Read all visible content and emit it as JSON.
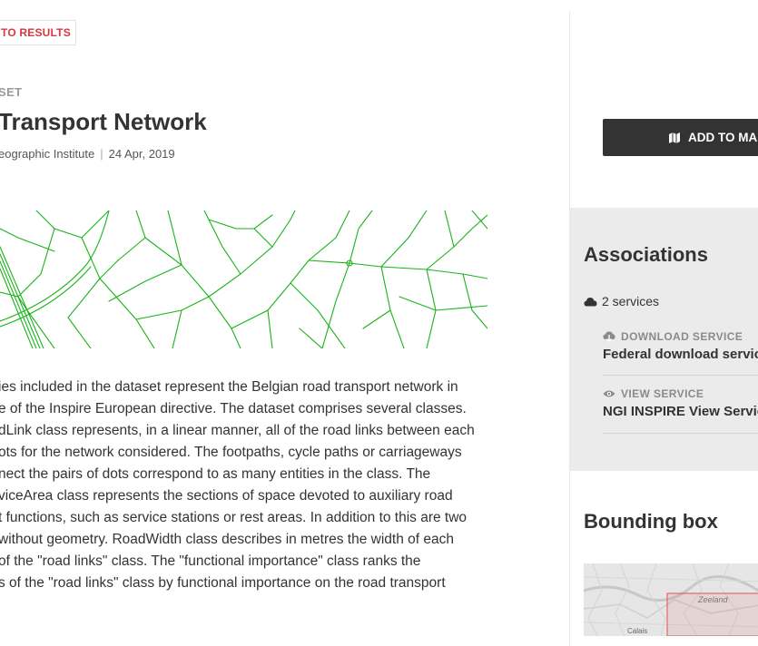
{
  "back": {
    "label": "TO RESULTS"
  },
  "record": {
    "kind": "SET",
    "title": "Transport Network",
    "publisher": "eographic Institute",
    "date": "24 Apr, 2019"
  },
  "description": [
    "ies included in the dataset represent the Belgian road transport network in",
    "e of the Inspire European directive. The dataset comprises several classes.",
    "dLink class represents, in a linear manner, all of the road links between each",
    "ots for the network considered. The footpaths, cycle paths or carriageways",
    "nect the pairs of dots correspond to as many entities in the class. The",
    "viceArea class represents the sections of space devoted to auxiliary road",
    "t functions, such as service stations or rest areas. In addition to this are two",
    "without geometry. RoadWidth class describes in metres the width of each",
    " of the \"road links\" class. The \"functional importance\" class ranks the",
    "s of the \"road links\" class by functional importance on the road transport"
  ],
  "actions": {
    "add_to_map": "ADD TO MAP"
  },
  "associations": {
    "title": "Associations",
    "count_label": "2 services",
    "services": [
      {
        "type": "DOWNLOAD SERVICE",
        "icon": "cloud-download-icon",
        "name": "Federal download service"
      },
      {
        "type": "VIEW SERVICE",
        "icon": "eye-icon",
        "name": "NGI INSPIRE View Service"
      }
    ]
  },
  "bounding_box": {
    "title": "Bounding box",
    "map_labels": [
      "Zeeland",
      "Calais"
    ]
  },
  "colors": {
    "accent_red": "#d9363e",
    "road_green": "#19b319",
    "dark_button": "#333333",
    "panel_gray": "#ebebeb",
    "bbox_red": "#e05050"
  }
}
